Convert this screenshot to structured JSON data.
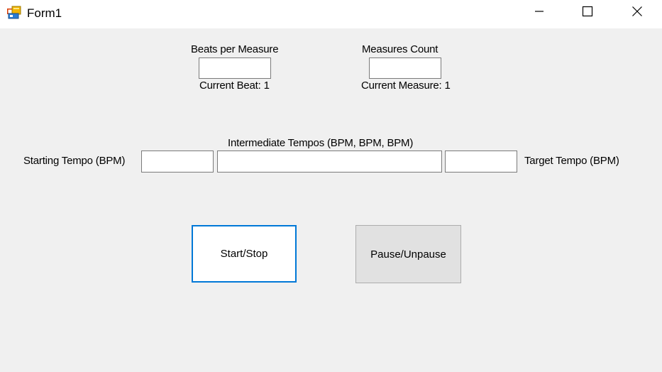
{
  "window": {
    "title": "Form1",
    "icon": "form-app-icon"
  },
  "controls": {
    "minimize_icon": "minimize-icon",
    "maximize_icon": "maximize-icon",
    "close_icon": "close-icon"
  },
  "beats": {
    "label": "Beats per Measure",
    "value": "",
    "current_label": "Current Beat: 1"
  },
  "measures": {
    "label": "Measures Count",
    "value": "",
    "current_label": "Current Measure: 1"
  },
  "tempo": {
    "intermediate_label": "Intermediate Tempos (BPM, BPM, BPM)",
    "starting_label": "Starting Tempo (BPM)",
    "target_label": "Target Tempo (BPM)",
    "starting_value": "",
    "intermediate_value": "",
    "target_value": ""
  },
  "buttons": {
    "start_stop": "Start/Stop",
    "pause_unpause": "Pause/Unpause"
  },
  "colors": {
    "focus_border": "#0078d7",
    "background": "#f0f0f0"
  }
}
